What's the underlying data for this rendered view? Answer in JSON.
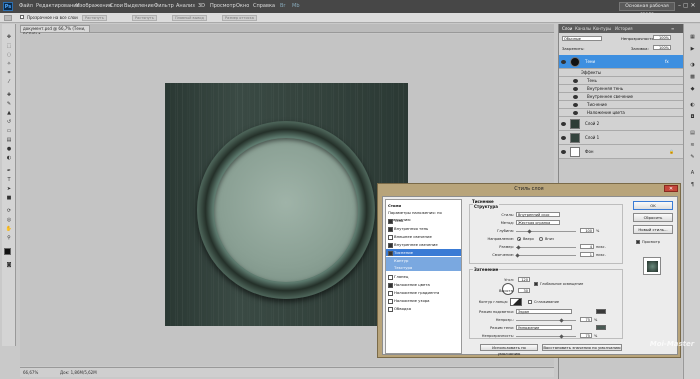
{
  "app": {
    "logo": "Ps"
  },
  "menu": [
    "Файл",
    "Редактирование",
    "Изображение",
    "Слои",
    "Выделение",
    "Фильтр",
    "Анализ",
    "3D",
    "Просмотр",
    "Окно",
    "Справка"
  ],
  "menu_extras": [
    "Br",
    "Mb"
  ],
  "workspace_button": "Основная рабочая среда",
  "window_controls": "– ▢ ✕",
  "options_bar": {
    "checkbox_label": "Прозрачное на все слои",
    "buttons": [
      "Растянуть",
      "Растянуть",
      "Плавный вывод",
      "Размер оттиска"
    ]
  },
  "document_tab": "документ.psd @ 66,7% (Тени, RGB/8) *",
  "status": {
    "zoom": "66,67%",
    "doc": "Док: 1,86M/5,62M"
  },
  "panel": {
    "tabs": [
      "Слои",
      "Каналы",
      "Контуры",
      "История"
    ],
    "blend_mode": "Обычные",
    "opacity_label": "Непрозрачность:",
    "opacity_value": "100%",
    "fill_label": "Заливка:",
    "fill_value": "100%",
    "lock_label": "Закрепить:",
    "layers": [
      {
        "name": "Тени",
        "selected": true,
        "fx": "fx"
      },
      {
        "name": "Эффекты",
        "sub": true
      },
      {
        "name": "Тень",
        "sub": true
      },
      {
        "name": "Внутренняя тень",
        "sub": true
      },
      {
        "name": "Внутреннее свечение",
        "sub": true
      },
      {
        "name": "Тиснение",
        "sub": true
      },
      {
        "name": "Наложение цвета",
        "sub": true
      },
      {
        "name": "Слой 2"
      },
      {
        "name": "Слой 1"
      },
      {
        "name": "Фон"
      }
    ]
  },
  "dialog": {
    "title": "Стиль слоя",
    "close": "✕",
    "styles": [
      {
        "label": "Стили",
        "type": "plain"
      },
      {
        "label": "Параметры наложения: по умолчанию",
        "type": "plain"
      },
      {
        "label": "Тень",
        "checked": true
      },
      {
        "label": "Внутренняя тень",
        "checked": true
      },
      {
        "label": "Внешнее свечение",
        "checked": false
      },
      {
        "label": "Внутреннее свечение",
        "checked": true
      },
      {
        "label": "Тиснение",
        "checked": true,
        "selected": true
      },
      {
        "label": "Контур",
        "checked": false,
        "subitem": true
      },
      {
        "label": "Текстура",
        "checked": false,
        "subitem": true
      },
      {
        "label": "Глянец",
        "checked": false
      },
      {
        "label": "Наложение цвета",
        "checked": true
      },
      {
        "label": "Наложение градиента",
        "checked": false
      },
      {
        "label": "Наложение узора",
        "checked": false
      },
      {
        "label": "Обводка",
        "checked": false
      }
    ],
    "bevel": {
      "group": "Тиснение",
      "structure": "Структура",
      "style_label": "Стиль:",
      "style_value": "Внутренний скос",
      "technique_label": "Метод:",
      "technique_value": "Жесткая огранка",
      "depth_label": "Глубина:",
      "depth_value": "100",
      "direction_label": "Направление:",
      "up": "Вверх",
      "down": "Вниз",
      "size_label": "Размер:",
      "size_value": "4",
      "soften_label": "Смягчение:",
      "soften_value": "1",
      "px": "пикс.",
      "pct": "%"
    },
    "shading": {
      "group": "Затенение",
      "angle_label": "Угол:",
      "angle_value": "120",
      "global_light": "Глобальное освещение",
      "altitude_label": "Высота:",
      "altitude_value": "30",
      "gloss_label": "Контур глянца:",
      "antialias": "Сглаживание",
      "highlight_label": "Режим подсветки:",
      "highlight_value": "Экран",
      "highlight_color": "#3a3a3a",
      "hl_opacity_label": "Непрозр.:",
      "hl_opacity_value": "75",
      "shadow_label": "Режим тени:",
      "shadow_value": "Умножение",
      "shadow_color": "#4a5a54",
      "sh_opacity_label": "Непрозрачность:",
      "sh_opacity_value": "75"
    },
    "buttons": {
      "default": "Использовать по умолчанию",
      "reset": "Восстановить значения по умолчанию"
    },
    "right": {
      "ok": "OK",
      "cancel": "Сбросить",
      "new_style": "Новый стиль...",
      "preview": "Просмотр"
    }
  },
  "watermark": "Moi-Master"
}
